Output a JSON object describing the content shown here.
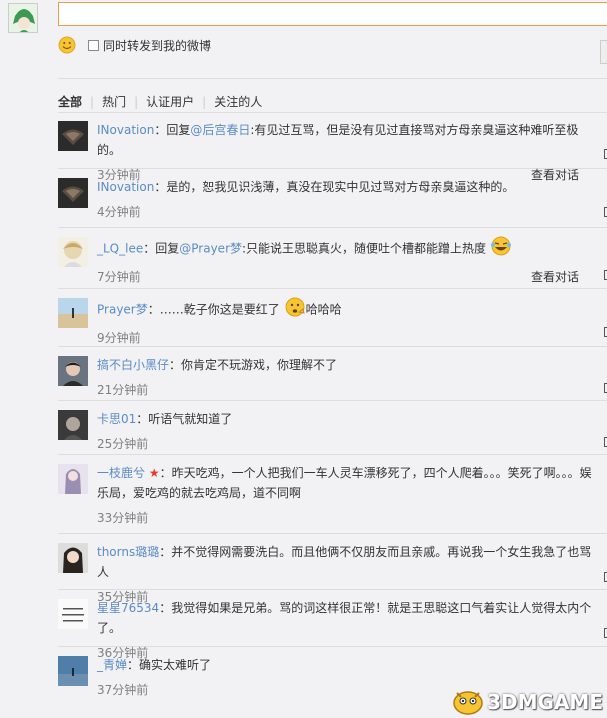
{
  "composer": {
    "input_value": "",
    "repost_label": "同时转发到我的微博"
  },
  "tabs": [
    {
      "label": "全部",
      "active": true
    },
    {
      "label": "热门",
      "active": false
    },
    {
      "label": "认证用户",
      "active": false
    },
    {
      "label": "关注的人",
      "active": false
    }
  ],
  "comments": [
    {
      "user": "INovation",
      "sep": "：",
      "reply_prefix": "回复",
      "reply_to": "@后宫春日",
      "text": ":有见过互骂，但是没有见过直接骂对方母亲臭逼这种难听至极的。",
      "time": "3分钟前",
      "reply_label": "查看对话"
    },
    {
      "user": "INovation",
      "sep": "：",
      "reply_prefix": "",
      "reply_to": "",
      "text": "是的，恕我见识浅薄，真没在现实中见过骂对方母亲臭逼这种的。",
      "time": "4分钟前",
      "reply_label": ""
    },
    {
      "user": "_LQ_lee",
      "sep": "：",
      "reply_prefix": "回复",
      "reply_to": "@Prayer梦",
      "text": ":只能说王思聪真火，随便吐个槽都能蹭上热度",
      "time": "7分钟前",
      "reply_label": "查看对话"
    },
    {
      "user": "Prayer梦",
      "sep": "：",
      "reply_prefix": "",
      "reply_to": "",
      "text": "……乾子你这是要红了",
      "text2": "哈哈哈",
      "time": "9分钟前",
      "reply_label": ""
    },
    {
      "user": "搞不白小黑仔",
      "sep": "：",
      "reply_prefix": "",
      "reply_to": "",
      "text": "你肯定不玩游戏，你理解不了",
      "time": "21分钟前",
      "reply_label": ""
    },
    {
      "user": "卡思01",
      "sep": "：",
      "reply_prefix": "",
      "reply_to": "",
      "text": "听语气就知道了",
      "time": "25分钟前",
      "reply_label": ""
    },
    {
      "user": "一枝鹿兮",
      "sep": "：",
      "reply_prefix": "",
      "reply_to": "",
      "text": "昨天吃鸡，一个人把我们一车人灵车漂移死了，四个人爬着。。。笑死了啊。。。娱乐局，爱吃鸡的就去吃鸡局，道不同啊",
      "time": "33分钟前",
      "reply_label": ""
    },
    {
      "user": "thorns璐璐",
      "sep": "：",
      "reply_prefix": "",
      "reply_to": "",
      "text": "并不觉得网需要洗白。而且他俩不仅朋友而且亲戚。再说我一个女生我急了也骂人",
      "time": "35分钟前",
      "reply_label": ""
    },
    {
      "user": "星星76534",
      "sep": "：",
      "reply_prefix": "",
      "reply_to": "",
      "text": "我觉得如果是兄弟。骂的词这样很正常！就是王思聪这口气着实让人觉得太内个了。",
      "time": "36分钟前",
      "reply_label": ""
    },
    {
      "user": "_青婵",
      "sep": "：",
      "reply_prefix": "",
      "reply_to": "",
      "text": "确实太难听了",
      "time": "37分钟前",
      "reply_label": ""
    }
  ],
  "star_glyph": "★",
  "watermark": "3DMGAME",
  "colors": {
    "link": "#5b8bc4",
    "input_border": "#f09a4a",
    "star": "#e83c2a"
  }
}
